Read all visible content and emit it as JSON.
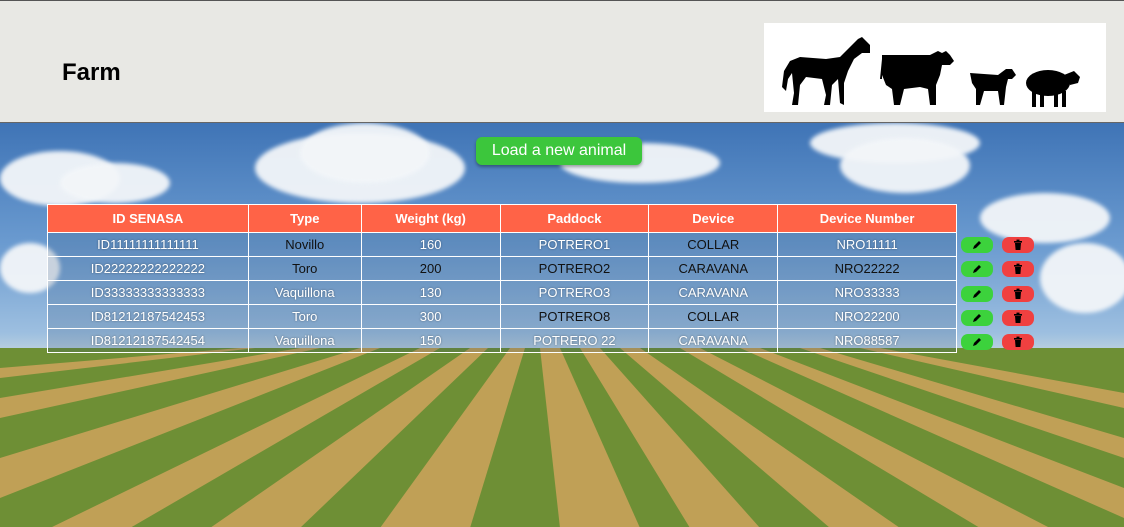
{
  "app": {
    "title": "Farm"
  },
  "toolbar": {
    "load_label": "Load a new animal"
  },
  "table": {
    "headers": [
      "ID SENASA",
      "Type",
      "Weight (kg)",
      "Paddock",
      "Device",
      "Device Number"
    ],
    "rows": [
      [
        "ID11111111111111",
        "Novillo",
        "160",
        "POTRERO1",
        "COLLAR",
        "NRO11111"
      ],
      [
        "ID22222222222222",
        "Toro",
        "200",
        "POTRERO2",
        "CARAVANA",
        "NRO22222"
      ],
      [
        "ID33333333333333",
        "Vaquillona",
        "130",
        "POTRERO3",
        "CARAVANA",
        "NRO33333"
      ],
      [
        "ID81212187542453",
        "Toro",
        "300",
        "POTRERO8",
        "COLLAR",
        "NRO22200"
      ],
      [
        "ID81212187542454",
        "Vaquillona",
        "150",
        "POTRERO 22",
        "CARAVANA",
        "NRO88587"
      ]
    ]
  },
  "icons": {
    "edit": "pencil-icon",
    "delete": "trash-icon"
  },
  "colors": {
    "header_bg": "#ff6347",
    "button": "#3cc63c",
    "edit": "#3cd23c",
    "delete": "#f04040"
  }
}
